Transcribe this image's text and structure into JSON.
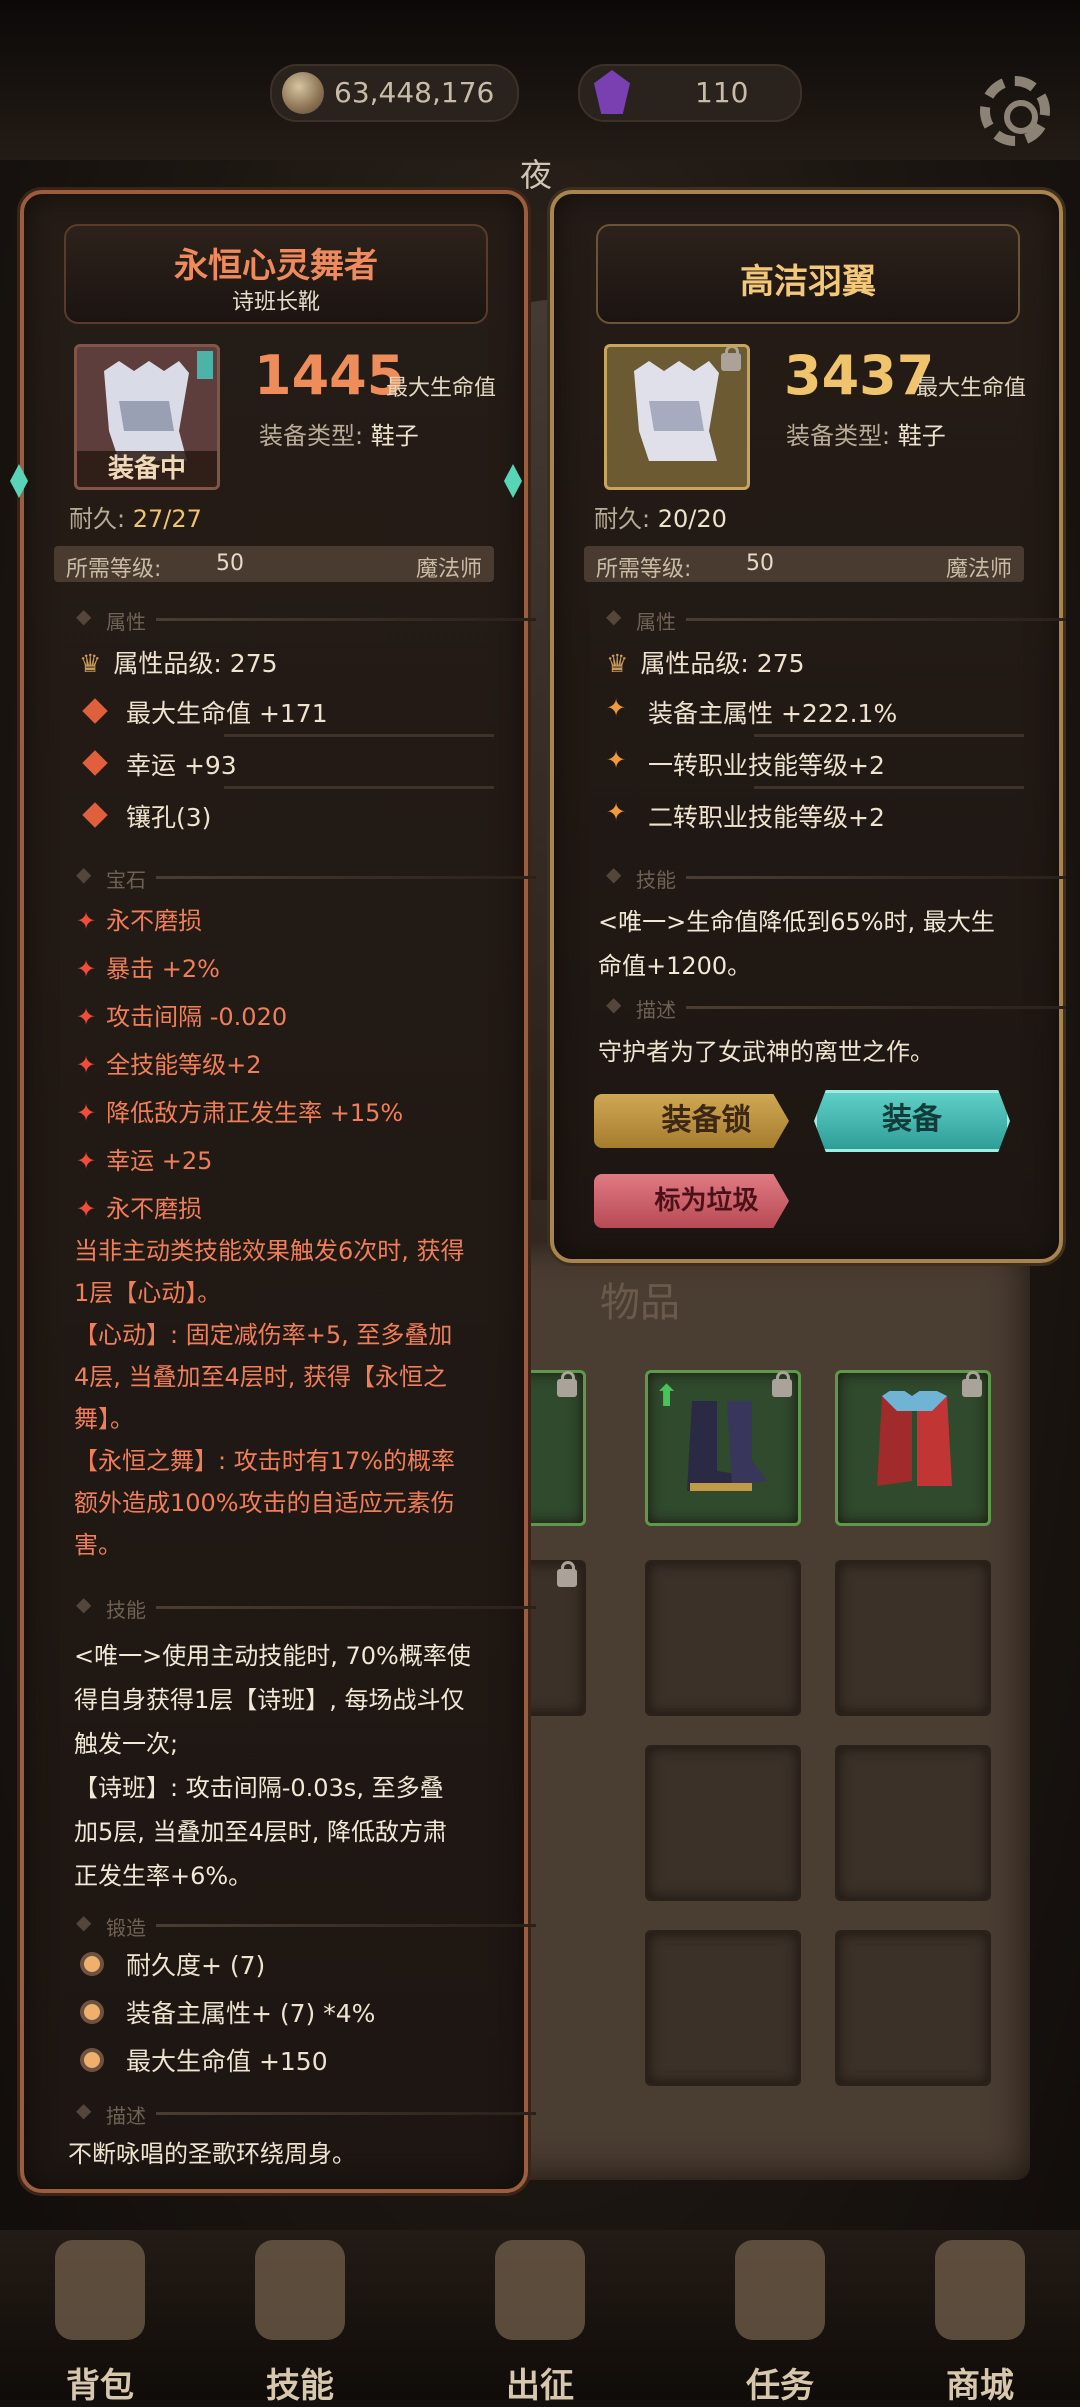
{
  "resources": {
    "gold": "63,448,176",
    "gems": "110"
  },
  "time_label": "夜",
  "left_item": {
    "name": "永恒心灵舞者",
    "subtitle": "诗班长靴",
    "equipped_tag": "装备中",
    "power": "1445",
    "power_label": "最大生命值",
    "type_label": "装备类型:",
    "type_value": "鞋子",
    "durability_label": "耐久:",
    "durability_value": "27/27",
    "req_label": "所需等级:",
    "req_level": "50",
    "req_class": "魔法师",
    "sections": {
      "attributes": "属性",
      "gems": "宝石",
      "skills": "技能",
      "forging": "锻造",
      "description": "描述"
    },
    "attribute_grade": "属性品级: 275",
    "attributes": [
      "最大生命值 +171",
      "幸运 +93",
      "镶孔(3)"
    ],
    "gems": [
      "永不磨损",
      "暴击 +2%",
      "攻击间隔 -0.020",
      "全技能等级+2",
      "降低敌方肃正发生率 +15%",
      "幸运 +25",
      "永不磨损"
    ],
    "gem_desc_lines": [
      "当非主动类技能效果触发6次时, 获得",
      "1层【心动】。",
      "【心动】: 固定减伤率+5, 至多叠加",
      "4层, 当叠加至4层时, 获得【永恒之",
      "舞】。",
      "【永恒之舞】: 攻击时有17%的概率",
      "额外造成100%攻击的自适应元素伤",
      "害。"
    ],
    "skill_lines": [
      "<唯一>使用主动技能时, 70%概率使",
      "得自身获得1层【诗班】, 每场战斗仅",
      "触发一次;",
      "【诗班】: 攻击间隔-0.03s, 至多叠",
      "加5层, 当叠加至4层时, 降低敌方肃",
      "正发生率+6%。"
    ],
    "forging": [
      "耐久度+ (7)",
      "装备主属性+ (7) *4%",
      "最大生命值 +150"
    ],
    "description": "不断咏唱的圣歌环绕周身。"
  },
  "right_item": {
    "name": "高洁羽翼",
    "power": "3437",
    "power_label": "最大生命值",
    "type_label": "装备类型:",
    "type_value": "鞋子",
    "durability_label": "耐久:",
    "durability_value": "20/20",
    "req_label": "所需等级:",
    "req_level": "50",
    "req_class": "魔法师",
    "sections": {
      "attributes": "属性",
      "skills": "技能",
      "description": "描述"
    },
    "attribute_grade": "属性品级: 275",
    "attributes": [
      "装备主属性 +222.1%",
      "一转职业技能等级+2",
      "二转职业技能等级+2"
    ],
    "skill_lines": [
      "<唯一>生命值降低到65%时, 最大生",
      "命值+1200。"
    ],
    "description": "守护者为了女武神的离世之作。",
    "buttons": {
      "lock": "装备锁",
      "equip": "装备",
      "trash": "标为垃圾"
    }
  },
  "inventory_label": "物品",
  "nav": [
    "背包",
    "技能",
    "出征",
    "任务",
    "商城"
  ],
  "colors": {
    "left_frame": "#9b5d3b",
    "right_frame": "#a9844f",
    "gem_text": "#ef7e5a",
    "equip_button": "#3fb8b0"
  }
}
